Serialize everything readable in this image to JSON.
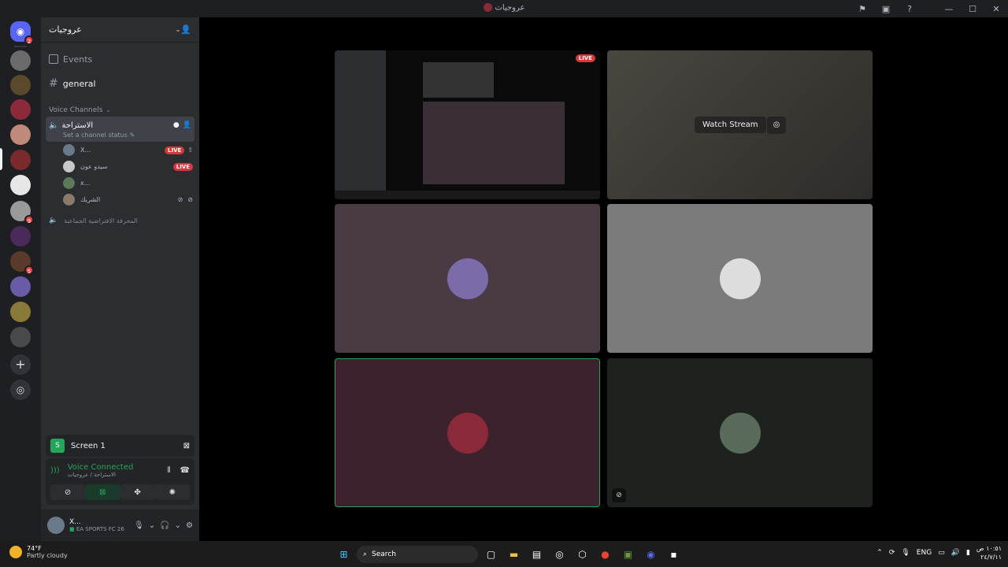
{
  "window": {
    "title": "عروجيات",
    "icons": [
      "inbox-icon",
      "help-icon",
      "minimize-icon",
      "maximize-icon",
      "close-icon"
    ]
  },
  "guilds": {
    "home_badge": "2",
    "badges": {
      "g8": "9",
      "g10": "5"
    }
  },
  "sidebar": {
    "server_name": "عروجيات",
    "events_label": "Events",
    "general_channel": "general",
    "voice_category": "Voice Channels",
    "active_voice": {
      "name": "الاستراحة",
      "status_placeholder": "Set a channel status",
      "members": [
        {
          "name": "X...",
          "live": "LIVE"
        },
        {
          "name": "سيدو عون",
          "live": "LIVE"
        },
        {
          "name": "x...",
          "live": ""
        },
        {
          "name": "الشريك",
          "live": ""
        }
      ]
    },
    "second_voice": "المحرقة الافتراضية الجماعية"
  },
  "bottom": {
    "screen_label": "Screen 1",
    "voice_connected": "Voice Connected",
    "voice_location": "الاستراحة / عروجيات",
    "user_name": "X...",
    "user_status": "EA SPORTS FC 26"
  },
  "stage": {
    "live_tag": "LIVE",
    "watch_stream": "Watch Stream"
  },
  "taskbar": {
    "temperature": "74°F",
    "weather": "Partly cloudy",
    "search_placeholder": "Search",
    "language": "ENG",
    "time": "١٠:٥١ ص",
    "date": "٢٤/٧/١١"
  },
  "colors": {
    "accent_green": "#23a55a",
    "live_red": "#da373c",
    "tile_purple": "#4a3a44",
    "tile_gray": "#7b7b7b",
    "tile_maroon": "#3b222c",
    "tile_dark": "#1e221f"
  }
}
